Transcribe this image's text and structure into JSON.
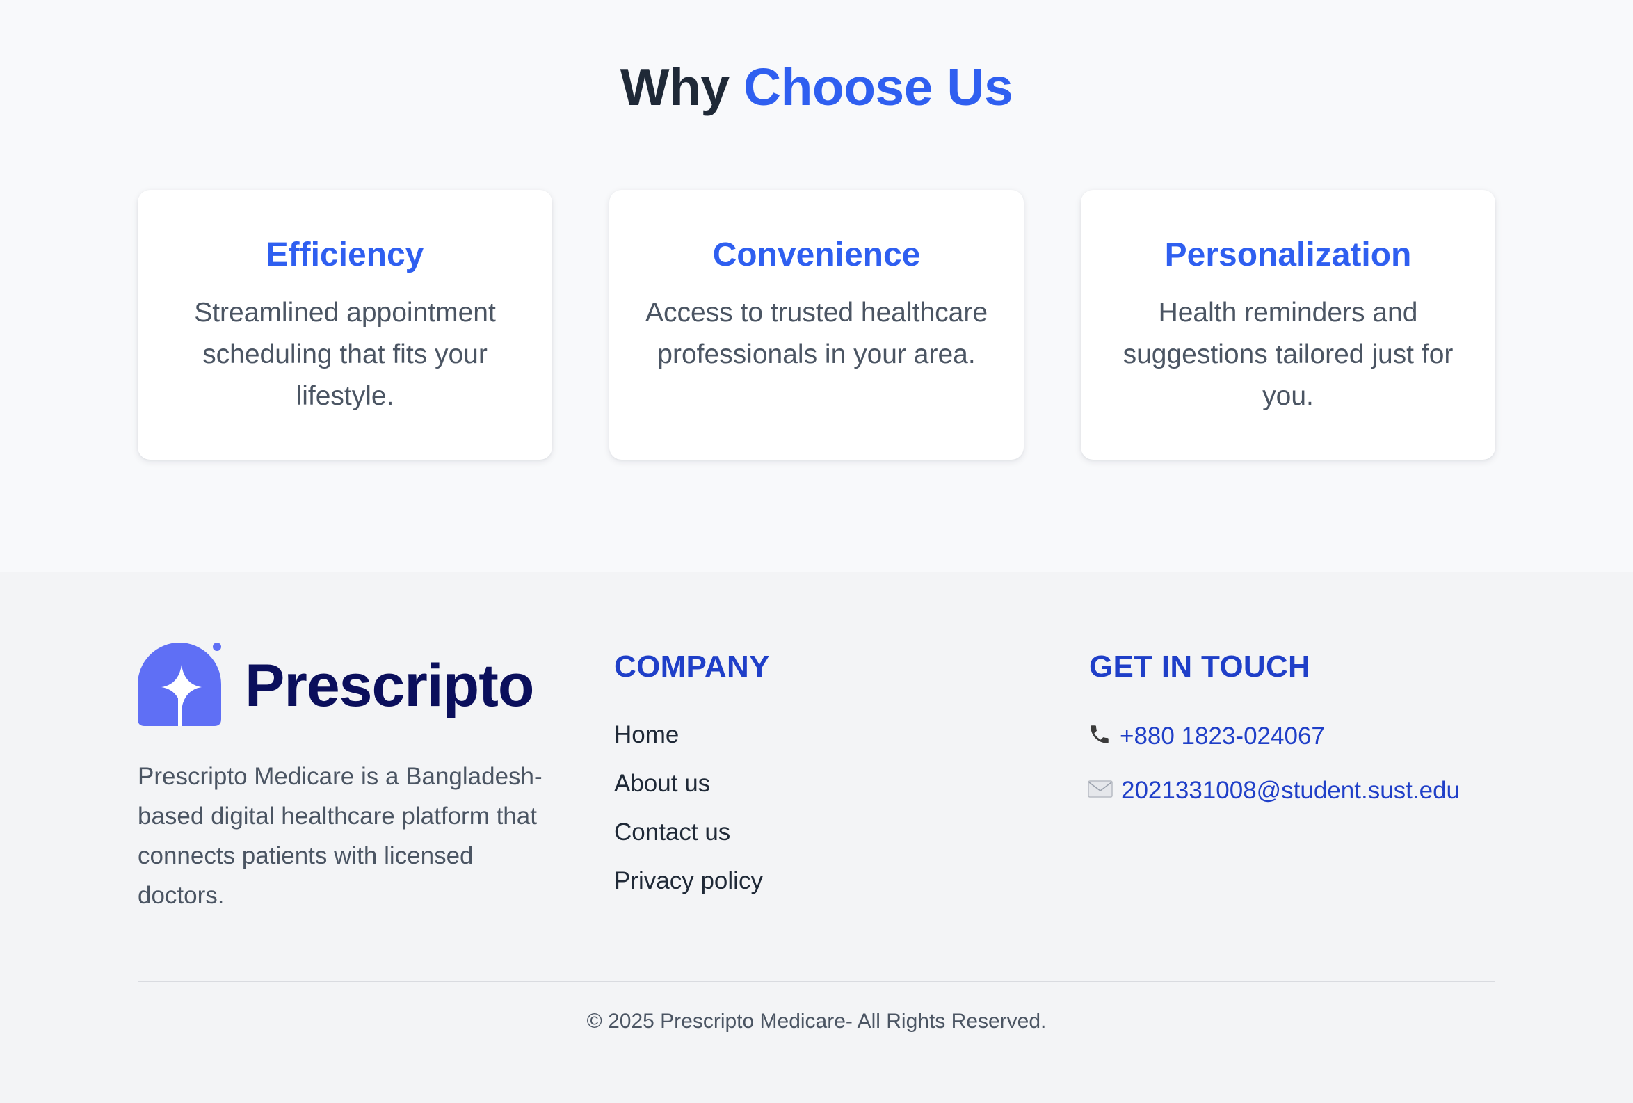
{
  "why_section": {
    "title_prefix": "Why",
    "title_accent": "Choose Us",
    "cards": [
      {
        "title": "Efficiency",
        "text": "Streamlined appointment scheduling that fits your lifestyle."
      },
      {
        "title": "Convenience",
        "text": "Access to trusted healthcare professionals in your area."
      },
      {
        "title": "Personalization",
        "text": "Health reminders and suggestions tailored just for you."
      }
    ]
  },
  "footer": {
    "brand": {
      "name": "Prescripto",
      "logo_icon": "prescripto-logo-icon",
      "description": "Prescripto Medicare is a Bangladesh-based digital healthcare platform that connects patients with licensed doctors."
    },
    "company": {
      "heading": "COMPANY",
      "links": [
        "Home",
        "About us",
        "Contact us",
        "Privacy policy"
      ]
    },
    "contact": {
      "heading": "GET IN TOUCH",
      "phone_icon": "phone-icon",
      "phone": "+880 1823-024067",
      "email_icon": "envelope-icon",
      "email": "2021331008@student.sust.edu"
    },
    "copyright": "© 2025 Prescripto Medicare- All Rights Reserved."
  },
  "colors": {
    "accent": "#2f5ff0",
    "footer_heading": "#1f3fc8",
    "brand_text": "#0b0f5c",
    "logo_icon": "#5f6ff5"
  }
}
